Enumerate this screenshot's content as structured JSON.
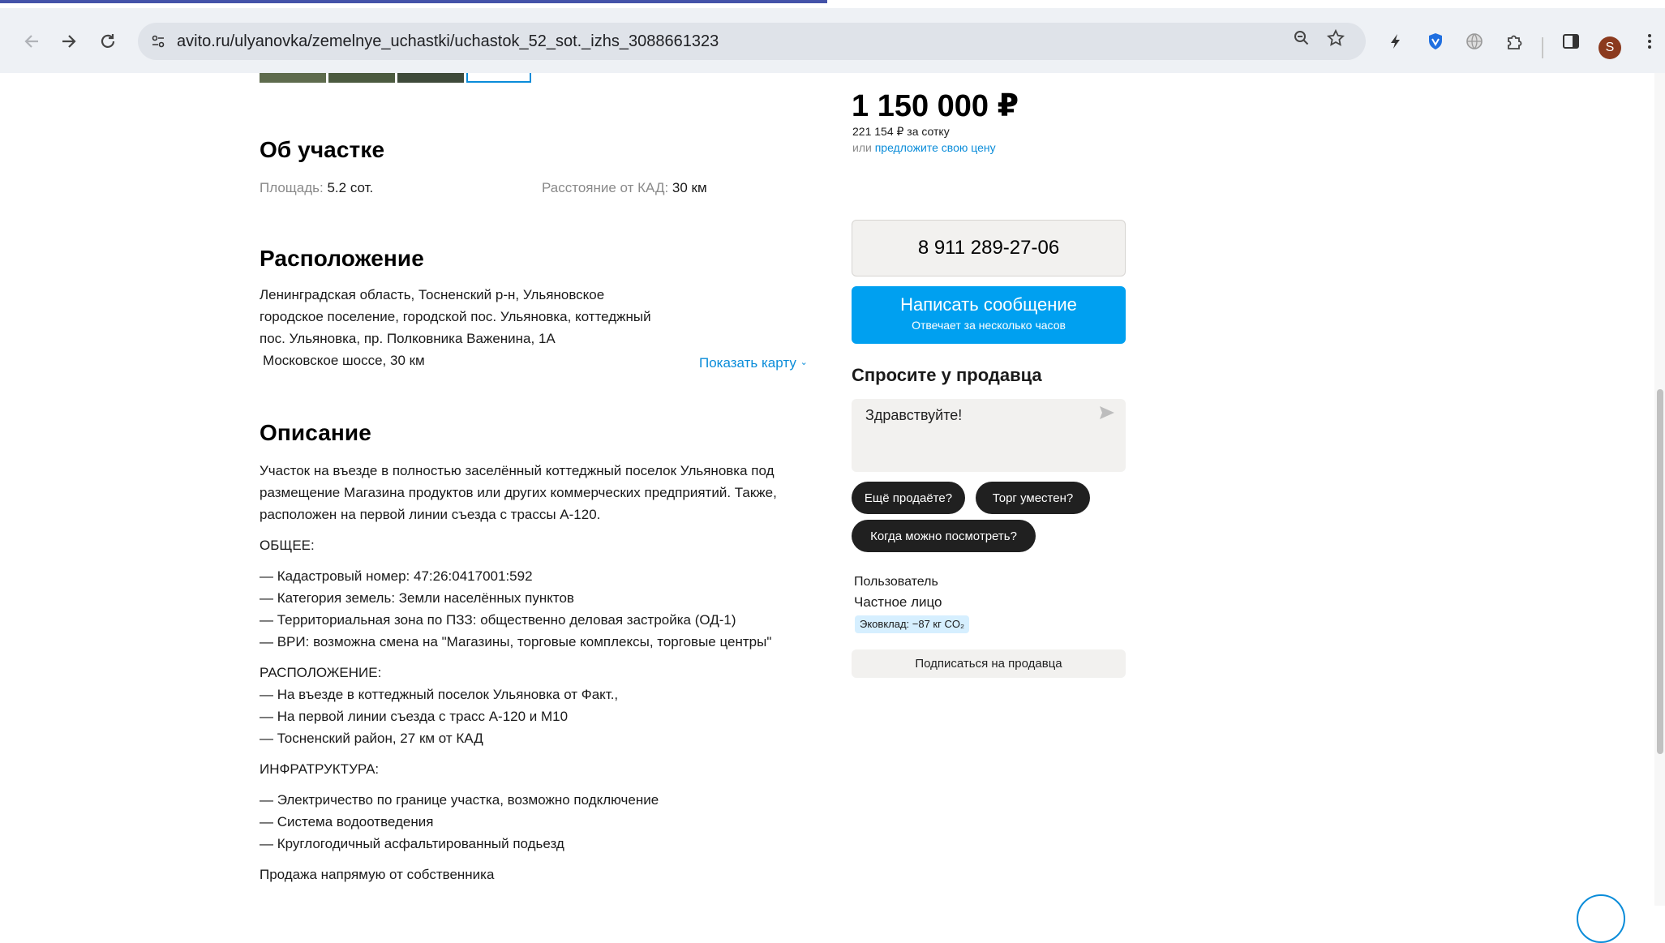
{
  "browser": {
    "url": "avito.ru/ulyanovka/zemelnye_uchastki/uchastok_52_sot._izhs_3088661323",
    "avatar_letter": "S",
    "icons": {
      "back": "arrow-left-icon",
      "forward": "arrow-right-icon",
      "reload": "reload-icon",
      "site_info": "tune-icon",
      "zoom": "zoom-icon",
      "bookmark": "star-icon",
      "ext1": "bolt-icon",
      "ext2": "shield-icon",
      "ext3": "globe-icon",
      "ext4": "puzzle-icon",
      "side_panel": "side-panel-icon",
      "menu": "kebab-menu-icon"
    }
  },
  "listing": {
    "price": "1 150 000 ₽",
    "price_per_sotka": "221 154 ₽ за сотку",
    "offer_prefix": "или",
    "offer_link": "предложите свою цену",
    "about": {
      "title": "Об участке",
      "area_label": "Площадь:",
      "area_value": "5.2 сот.",
      "distance_label": "Расстояние от КАД:",
      "distance_value": "30 км"
    },
    "location": {
      "title": "Расположение",
      "address_lines": [
        "Ленинградская область, Тосненский р-н, Ульяновское",
        "городское поселение, городской пос. Ульяновка, коттеджный",
        "пос. Ульяновка, пр. Полковника Важенина, 1А"
      ],
      "highway": "Московское шоссе, 30 км",
      "show_map": "Показать карту"
    },
    "description": {
      "title": "Описание",
      "intro_lines": [
        "Участок на въезде в полностью заселённый коттеджный поселок Ульяновка под",
        "размещение Магазина продуктов или других коммерческих предприятий. Также,",
        "расположен на первой линии съезда с трассы А-120."
      ],
      "general_heading": "ОБЩЕЕ:",
      "general_items": [
        "— Кадастровый номер: 47:26:0417001:592",
        "— Категория земель: Земли населённых пунктов",
        "— Территориальная зона по ПЗЗ: общественно деловая застройка (ОД-1)",
        "— ВРИ: возможна смена на \"Магазины, торговые комплексы, торговые центры\""
      ],
      "location_heading": "РАСПОЛОЖЕНИЕ:",
      "location_items": [
        "— На въезде в коттеджный поселок Ульяновка от Факт.,",
        "— На первой линии съезда с трасс А-120 и М10",
        "— Тосненский район, 27 км от КАД"
      ],
      "infra_heading": "ИНФРАТРУКТУРА:",
      "infra_items": [
        "— Электричество по границе участка, возможно подключение",
        "— Система водоотведения",
        "— Круглогодичный асфальтированный подьезд"
      ],
      "closing": "Продажа напрямую от собственника"
    }
  },
  "seller": {
    "phone": "8 911 289-27-06",
    "message_button": "Написать сообщение",
    "message_sub": "Отвечает за несколько часов",
    "ask_title": "Спросите у продавца",
    "ask_value": "Здравствуйте!",
    "quick_replies": [
      "Ещё продаёте?",
      "Торг уместен?",
      "Когда можно посмотреть?"
    ],
    "user_label": "Пользователь",
    "user_type": "Частное лицо",
    "eco_badge": "Эковклад: −87 кг CO₂",
    "subscribe": "Подписаться на продавца"
  }
}
